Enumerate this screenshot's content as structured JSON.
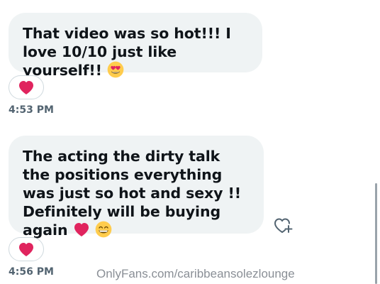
{
  "messages": [
    {
      "text": "That video was so hot!!! I love 10/10 just like yourself!!",
      "emoji": "smiling-face-with-heart-eyes",
      "reaction": "red-heart",
      "time": "4:53 PM"
    },
    {
      "text": "The acting the dirty talk the positions everything was just so hot and sexy !! Definitely will be buying again",
      "emoji": [
        "red-heart",
        "grinning-face-with-smiling-eyes"
      ],
      "reaction": "red-heart",
      "time": "4:56 PM"
    }
  ],
  "watermark": "OnlyFans.com/caribbeansolezlounge",
  "colors": {
    "bubble_bg": "#eff3f4",
    "text": "#0f1419",
    "timestamp": "#536471",
    "heart": "#e0245e",
    "reaction_border": "#cfd9de"
  }
}
